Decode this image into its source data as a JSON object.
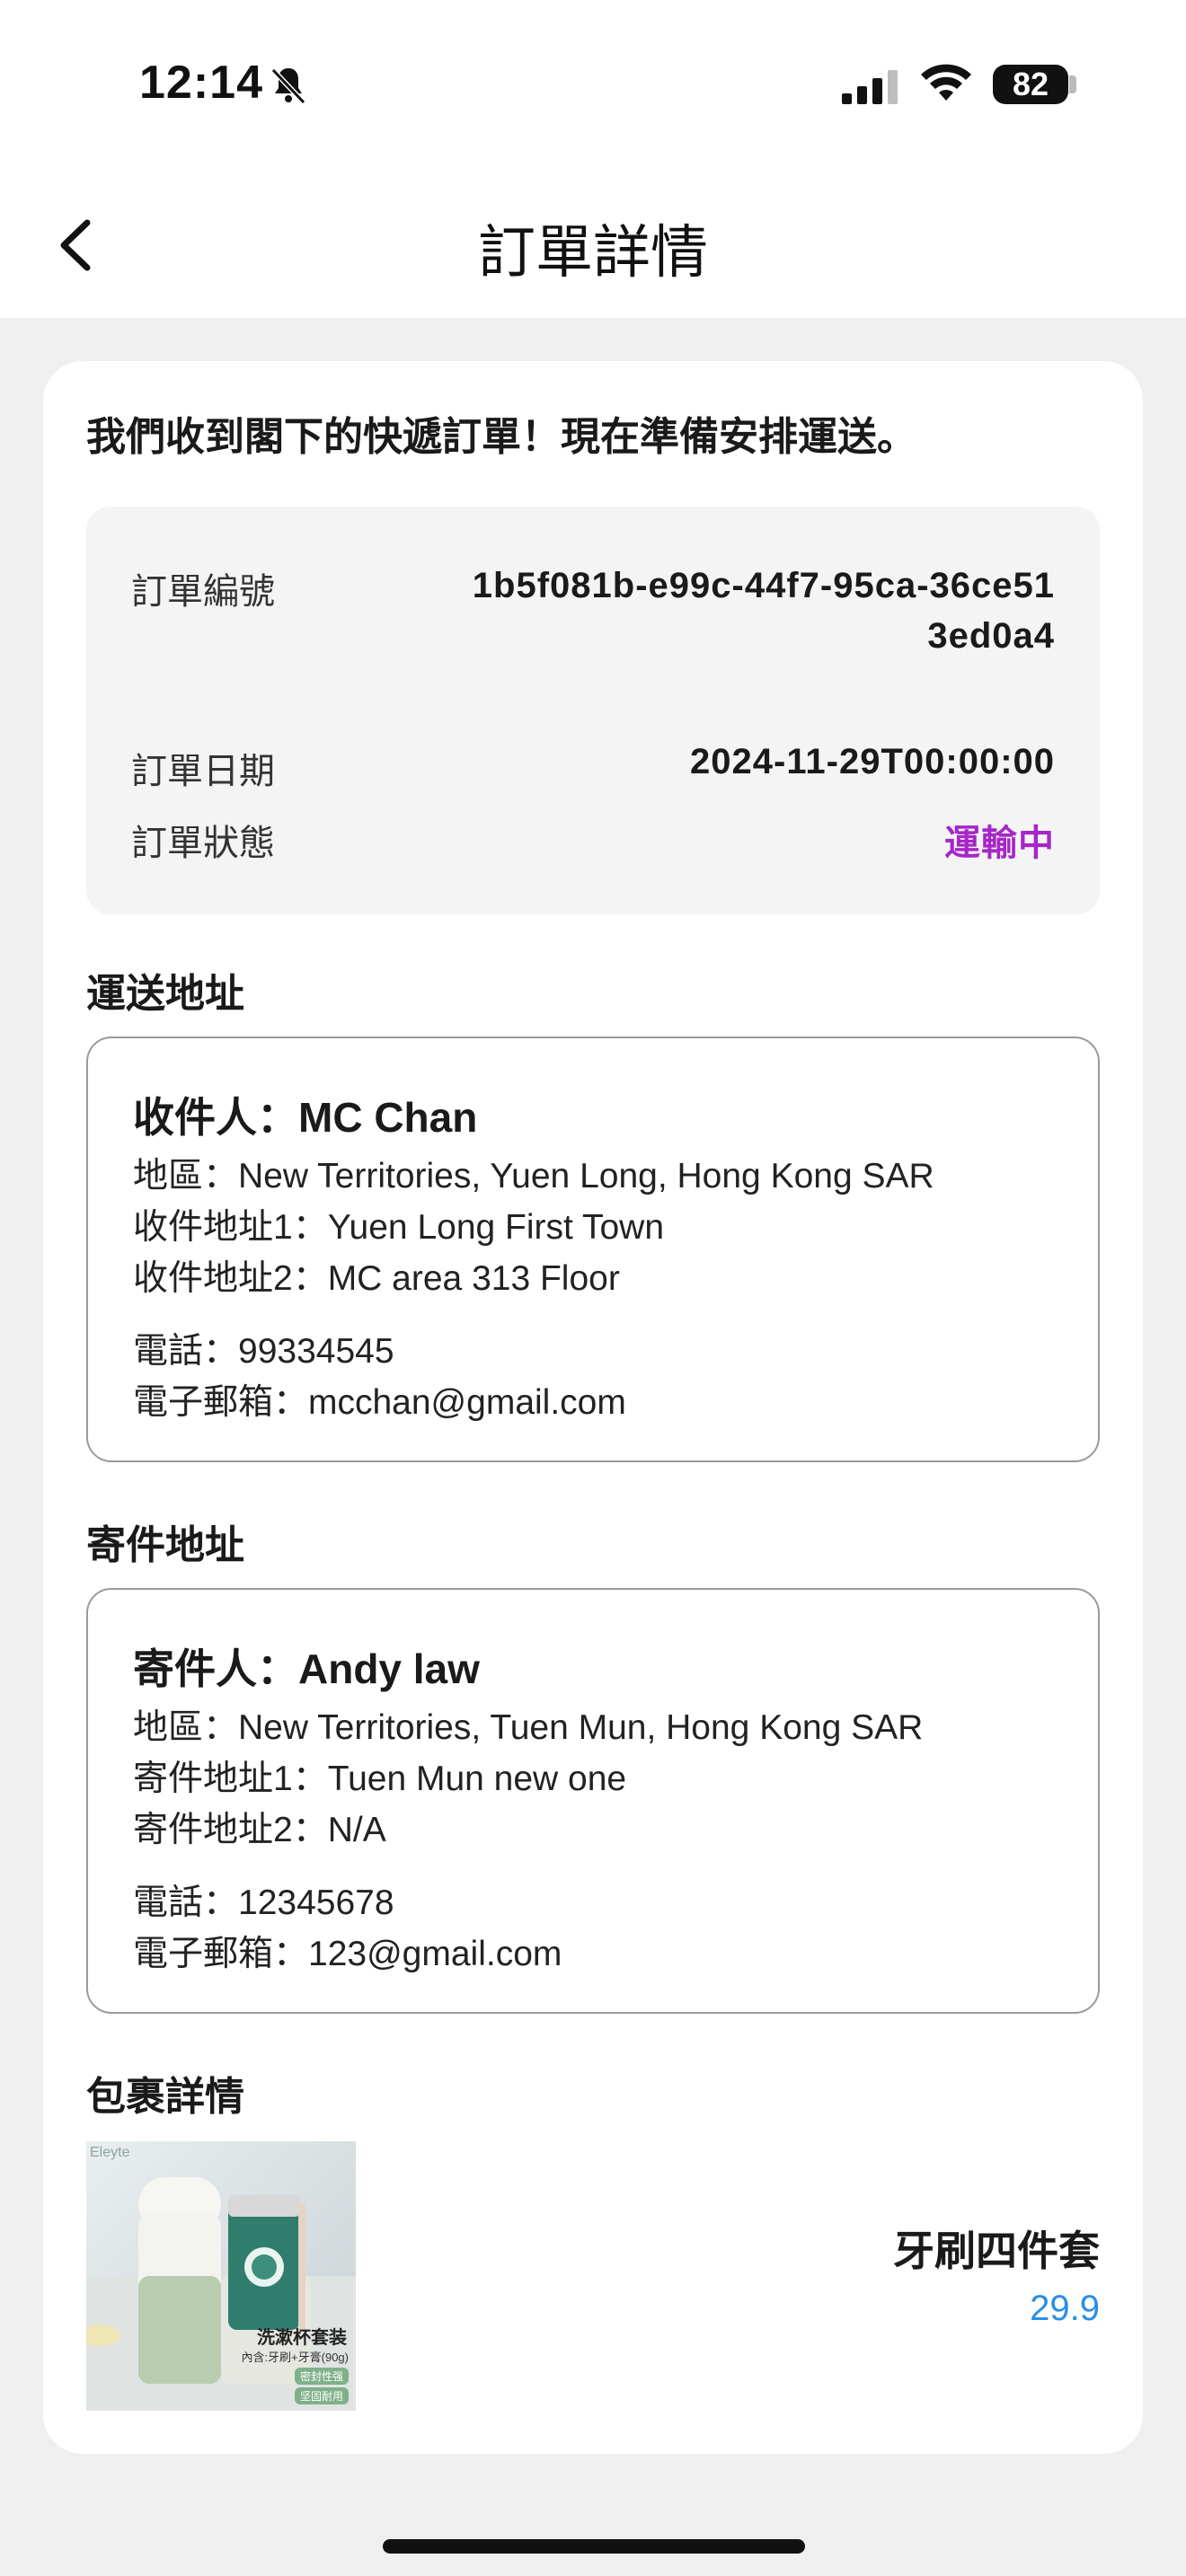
{
  "status_bar": {
    "time": "12:14",
    "battery": "82",
    "icons": [
      "bell-slash-icon",
      "signal-icon",
      "wifi-icon",
      "battery-icon"
    ]
  },
  "nav": {
    "title": "訂單詳情",
    "back_icon": "chevron-left-icon"
  },
  "headline": "我們收到閣下的快遞訂單！現在準備安排運送。",
  "order": {
    "id_label": "訂單編號",
    "id_value": "1b5f081b-e99c-44f7-95ca-36ce513ed0a4",
    "date_label": "訂單日期",
    "date_value": "2024-11-29T00:00:00",
    "status_label": "訂單狀態",
    "status_value": "運輸中",
    "status_color": "#a626c8"
  },
  "shipping": {
    "title": "運送地址",
    "name": "收件人：MC Chan",
    "region": "地區：New Territories, Yuen Long, Hong Kong SAR",
    "address1": "收件地址1：Yuen Long First Town",
    "address2": "收件地址2：MC area 313 Floor",
    "phone": "電話：99334545",
    "email": "電子郵箱：mcchan@gmail.com"
  },
  "sender": {
    "title": "寄件地址",
    "name": "寄件人：Andy law",
    "region": "地區：New Territories, Tuen Mun, Hong Kong SAR",
    "address1": "寄件地址1：Tuen Mun new one",
    "address2": "寄件地址2：N/A",
    "phone": "電話：12345678",
    "email": "電子郵箱：123@gmail.com"
  },
  "package": {
    "title": "包裹詳情",
    "product_name": "牙刷四件套",
    "price": "29.9",
    "price_color": "#2a8ee8",
    "image_caption": "洗漱杯套装",
    "image_subcaption": "內含:牙刷+牙膏(90g)",
    "image_tag1": "密封性强",
    "image_tag2": "坚固耐用",
    "image_brand": "Eleyte"
  }
}
